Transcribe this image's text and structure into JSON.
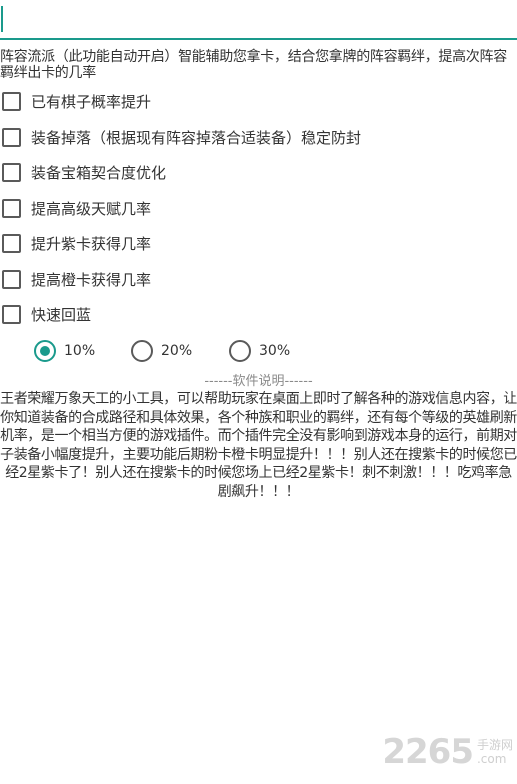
{
  "intro_text": "阵容流派（此功能自动开启）智能辅助您拿卡，结合您拿牌的阵容羁绊，提高次阵容羁绊出卡的几率",
  "options": [
    {
      "label": "已有棋子概率提升",
      "checked": false
    },
    {
      "label": "装备掉落（根据现有阵容掉落合适装备）稳定防封",
      "checked": false
    },
    {
      "label": "装备宝箱契合度优化",
      "checked": false
    },
    {
      "label": "提高高级天赋几率",
      "checked": false
    },
    {
      "label": "提升紫卡获得几率",
      "checked": false
    },
    {
      "label": "提高橙卡获得几率",
      "checked": false
    },
    {
      "label": "快速回蓝",
      "checked": false
    }
  ],
  "rates": [
    {
      "label": "10%",
      "selected": true
    },
    {
      "label": "20%",
      "selected": false
    },
    {
      "label": "30%",
      "selected": false
    }
  ],
  "section_title": "------软件说明------",
  "description": "王者荣耀万象天工的小工具，可以帮助玩家在桌面上即时了解各种的游戏信息内容，让你知道装备的合成路径和具体效果，各个种族和职业的羁绊，还有每个等级的英雄刷新机率，是一个相当方便的游戏插件。而个插件完全没有影响到游戏本身的运行，前期对子装备小幅度提升，主要功能后期粉卡橙卡明显提升！！！别人还在搜紫卡的时候您已经2星紫卡了！别人还在搜紫卡的时候您场上已经2星紫卡！刺不刺激！！！吃鸡率急剧飙升！！！",
  "watermark": {
    "number": "2265",
    "suffix": "手游网",
    "suffix2": ".com"
  },
  "colors": {
    "accent": "#1a9a8c",
    "text": "#333333",
    "muted": "#8a8a8a"
  }
}
